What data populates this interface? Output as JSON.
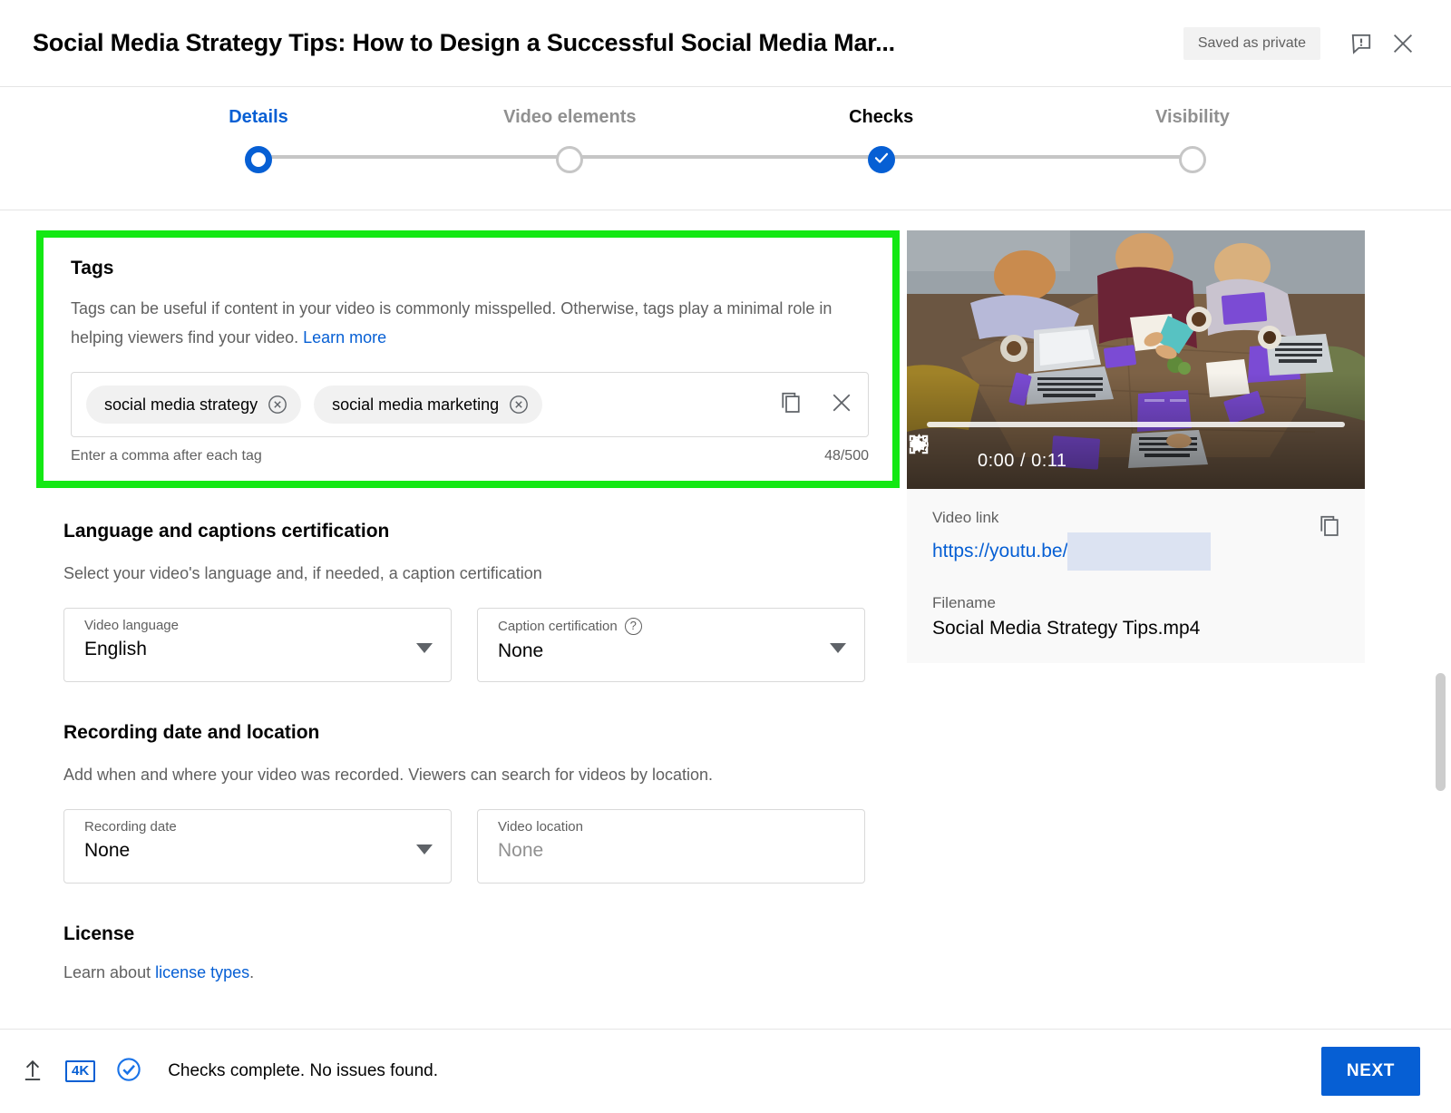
{
  "header": {
    "title": "Social Media Strategy Tips: How to Design a Successful Social Media Mar...",
    "saved_status": "Saved as private",
    "feedback_icon": "feedback-exclamation-bubble-icon",
    "close_icon": "close-x-icon"
  },
  "stepper": {
    "steps": [
      {
        "label": "Details",
        "state": "active"
      },
      {
        "label": "Video elements",
        "state": "todo"
      },
      {
        "label": "Checks",
        "state": "done"
      },
      {
        "label": "Visibility",
        "state": "todo"
      }
    ],
    "accent_color": "#065fd4",
    "inactive_color": "#c6c6c6"
  },
  "highlight": {
    "color": "#14e814"
  },
  "tags": {
    "title": "Tags",
    "description_part1": "Tags can be useful if content in your video is commonly misspelled. Otherwise, tags play a minimal role in helping viewers find your video. ",
    "learn_more": "Learn more",
    "chips": [
      {
        "label": "social media strategy"
      },
      {
        "label": "social media marketing"
      }
    ],
    "hint": "Enter a comma after each tag",
    "counter": "48/500",
    "copy_icon": "copy-icon",
    "clear_icon": "clear-x-icon"
  },
  "language_section": {
    "title": "Language and captions certification",
    "description": "Select your video's language and, if needed, a caption certification",
    "video_language": {
      "label": "Video language",
      "value": "English"
    },
    "caption_certification": {
      "label": "Caption certification",
      "value": "None",
      "help_icon": "help-question-icon"
    }
  },
  "recording_section": {
    "title": "Recording date and location",
    "description": "Add when and where your video was recorded. Viewers can search for videos by location.",
    "recording_date": {
      "label": "Recording date",
      "value": "None"
    },
    "video_location": {
      "label": "Video location",
      "value": "None",
      "is_placeholder": true
    }
  },
  "license_section": {
    "title": "License",
    "description_prefix": "Learn about ",
    "link_text": "license types",
    "description_suffix": "."
  },
  "video_panel": {
    "player": {
      "play_icon": "play-triangle-icon",
      "volume_icon": "volume-speaker-icon",
      "time": "0:00 / 0:11",
      "settings_icon": "gear-icon",
      "fullscreen_icon": "fullscreen-expand-icon",
      "progress_percent": 0
    },
    "video_link_label": "Video link",
    "video_link_prefix": "https://youtu.be/",
    "video_link_redacted": true,
    "filename_label": "Filename",
    "filename_value": "Social Media Strategy Tips.mp4",
    "copy_link_icon": "copy-icon"
  },
  "footer": {
    "upload_icon": "upload-arrow-icon",
    "resolution_badge": "4K",
    "checks_icon": "check-circle-icon",
    "status_text": "Checks complete. No issues found.",
    "next_label": "NEXT",
    "next_color": "#065fd4"
  }
}
